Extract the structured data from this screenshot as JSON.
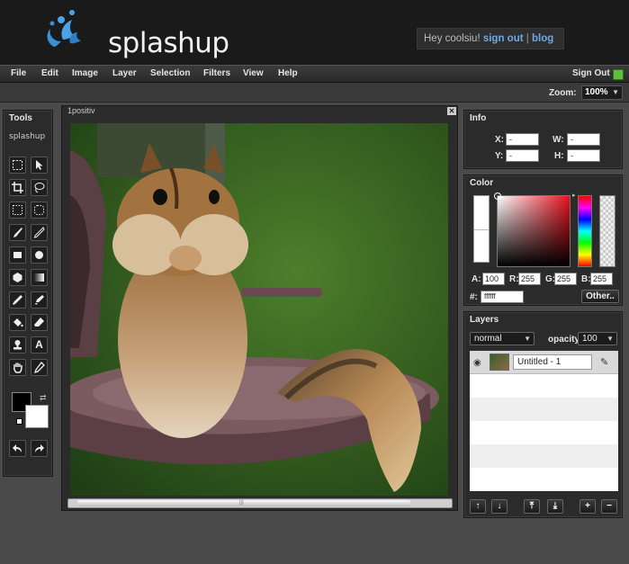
{
  "app": {
    "name": "splashup"
  },
  "user_box": {
    "greeting": "Hey coolsiu!",
    "sign_out": "sign out",
    "separator": "|",
    "blog": "blog"
  },
  "menu": {
    "items": [
      "File",
      "Edit",
      "Image",
      "Layer",
      "Selection",
      "Filters",
      "View",
      "Help"
    ],
    "sign_out": "Sign Out"
  },
  "toolbar": {
    "zoom_label": "Zoom:",
    "zoom_value": "100%"
  },
  "tools": {
    "title": "Tools",
    "logo_text": "splashup",
    "items": [
      "marquee-select",
      "move",
      "crop",
      "lasso",
      "rect-select",
      "ellipse-select",
      "brush",
      "pencil",
      "rectangle",
      "ellipse",
      "polygon",
      "gradient",
      "eyedropper",
      "smudge",
      "fill",
      "eraser",
      "stamp",
      "text",
      "hand",
      "picker",
      "undo",
      "redo"
    ],
    "text_tool_label": "A",
    "foreground_color": "#000000",
    "background_color": "#ffffff"
  },
  "canvas": {
    "title": "1positiv"
  },
  "info": {
    "title": "Info",
    "x_label": "X:",
    "x_value": "-",
    "y_label": "Y:",
    "y_value": "-",
    "w_label": "W:",
    "w_value": "-",
    "h_label": "H:",
    "h_value": "-"
  },
  "color": {
    "title": "Color",
    "a_label": "A:",
    "a_value": "100",
    "r_label": "R:",
    "r_value": "255",
    "g_label": "G:",
    "g_value": "255",
    "b_label": "B:",
    "b_value": "255",
    "hex_label": "#:",
    "hex_value": "ffffff",
    "other_label": "Other.."
  },
  "layers": {
    "title": "Layers",
    "blend_mode": "normal",
    "opacity_label": "opacity:",
    "opacity_value": "100",
    "items": [
      {
        "name": "Untitled - 1"
      }
    ]
  }
}
